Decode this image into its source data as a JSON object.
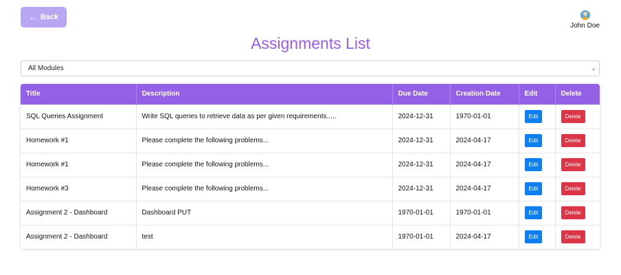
{
  "header": {
    "back_label": "Back",
    "user_name": "John Doe",
    "page_title": "Assignments List"
  },
  "filter": {
    "selected": "All Modules"
  },
  "table": {
    "columns": [
      "Title",
      "Description",
      "Due Date",
      "Creation Date",
      "Edit",
      "Delete"
    ],
    "rows": [
      {
        "title": "SQL Queries Assignment",
        "description": "Write SQL queries to retrieve data as per given requirements.....",
        "due": "2024-12-31",
        "created": "1970-01-01",
        "edit": "Edit",
        "delete": "Delete"
      },
      {
        "title": "Homework #1",
        "description": "Please complete the following problems...",
        "due": "2024-12-31",
        "created": "2024-04-17",
        "edit": "Edit",
        "delete": "Delete"
      },
      {
        "title": "Homework #1",
        "description": "Please complete the following problems...",
        "due": "2024-12-31",
        "created": "2024-04-17",
        "edit": "Edit",
        "delete": "Delete"
      },
      {
        "title": "Homework #3",
        "description": "Please complete the following problems...",
        "due": "2024-12-31",
        "created": "2024-04-17",
        "edit": "Edit",
        "delete": "Delete"
      },
      {
        "title": "Assignment 2 - Dashboard",
        "description": "Dashboard PUT",
        "due": "1970-01-01",
        "created": "1970-01-01",
        "edit": "Edit",
        "delete": "Delete"
      },
      {
        "title": "Assignment 2 - Dashboard",
        "description": "test",
        "due": "1970-01-01",
        "created": "2024-04-17",
        "edit": "Edit",
        "delete": "Delete"
      }
    ]
  },
  "icons": {
    "back": "arrow-left-icon",
    "user": "user-avatar-icon",
    "select": "chevron-down-icon"
  },
  "colors": {
    "accent": "#9461e6",
    "title": "#9b5de5",
    "back_button": "#b9a6f3",
    "edit_button": "#0d7ff0",
    "delete_button": "#dc3545"
  }
}
